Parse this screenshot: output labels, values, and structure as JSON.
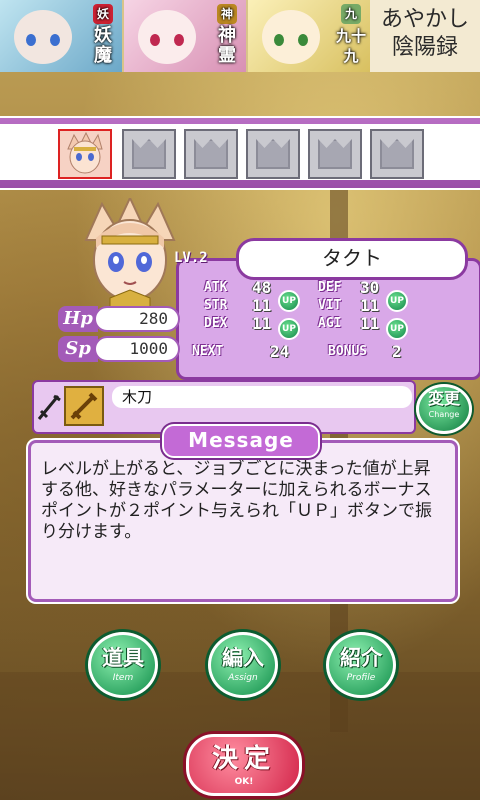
{
  "banner": {
    "characters": [
      {
        "tag_line1": "妖",
        "tag_line2": "魔",
        "crest": "妖"
      },
      {
        "tag_line1": "神",
        "tag_line2": "霊",
        "crest": "神"
      },
      {
        "tag_line1": "九十",
        "tag_line2": "九",
        "crest": "九"
      }
    ],
    "title_line1": "あやかし",
    "title_line2": "陰陽録"
  },
  "party": {
    "slots": [
      "active",
      "empty",
      "empty",
      "empty",
      "empty",
      "empty"
    ]
  },
  "status": {
    "level": "LV.2",
    "name": "タクト",
    "hp_label": "Hp",
    "hp_value": "280",
    "sp_label": "Sp",
    "sp_value": "1000",
    "stats": [
      {
        "label": "ATK",
        "value": "48"
      },
      {
        "label": "STR",
        "value": "11"
      },
      {
        "label": "DEX",
        "value": "11"
      },
      {
        "label": "DEF",
        "value": "30"
      },
      {
        "label": "VIT",
        "value": "11"
      },
      {
        "label": "AGI",
        "value": "11"
      }
    ],
    "up_label": "UP",
    "next_label": "NEXT",
    "next_value": "24",
    "bonus_label": "BONUS",
    "bonus_value": "2"
  },
  "weapon": {
    "name": "木刀",
    "change_jp": "変更",
    "change_en": "Change"
  },
  "message": {
    "title": "Message",
    "text": "レベルが上がると、ジョブごとに決まった値が上昇する他、好きなパラメーターに加えられるボーナスポイントが２ポイント与えられ「ＵＰ」ボタンで振り分けます。"
  },
  "buttons": {
    "item_jp": "道具",
    "item_en": "Item",
    "assign_jp": "編入",
    "assign_en": "Assign",
    "profile_jp": "紹介",
    "profile_en": "Profile",
    "ok_jp": "決定",
    "ok_en": "OK!"
  },
  "colors": {
    "panel_purple": "#a35bb8",
    "button_green": "#0e8c48",
    "ok_red": "#d3264a"
  }
}
